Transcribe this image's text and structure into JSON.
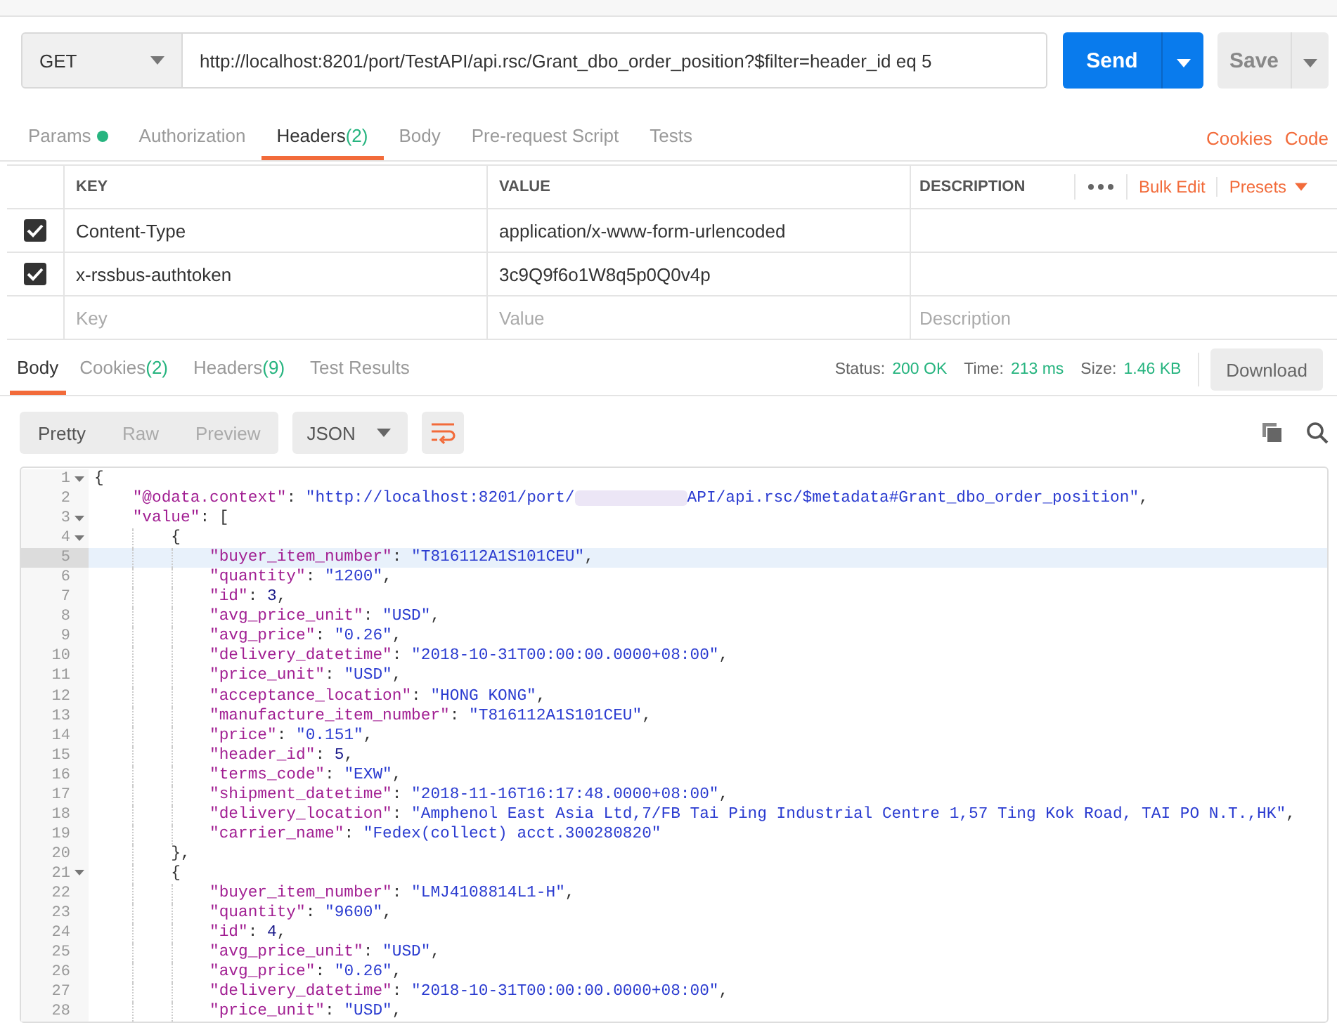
{
  "request": {
    "method": "GET",
    "url": "http://localhost:8201/port/TestAPI/api.rsc/Grant_dbo_order_position?$filter=header_id eq 5",
    "send": "Send",
    "save": "Save"
  },
  "request_tabs": [
    {
      "label": "Params",
      "dot": true,
      "selected": false
    },
    {
      "label": "Authorization",
      "dot": false,
      "selected": false
    },
    {
      "label": "Headers",
      "count": "(2)",
      "dot": false,
      "selected": true
    },
    {
      "label": "Body",
      "dot": false,
      "selected": false
    },
    {
      "label": "Pre-request Script",
      "dot": false,
      "selected": false
    },
    {
      "label": "Tests",
      "dot": false,
      "selected": false
    }
  ],
  "request_links": [
    "Cookies",
    "Code"
  ],
  "headers_table": {
    "columns": [
      "KEY",
      "VALUE",
      "DESCRIPTION"
    ],
    "bulk_edit": "Bulk Edit",
    "presets": "Presets",
    "rows": [
      {
        "key": "Content-Type",
        "value": "application/x-www-form-urlencoded",
        "checked": true
      },
      {
        "key": "x-rssbus-authtoken",
        "value": "3c9Q9f6o1W8q5p0Q0v4p",
        "checked": true
      }
    ],
    "new_row": [
      {
        "placeholder": "Key"
      },
      {
        "placeholder": "Value"
      },
      {
        "placeholder": "Description"
      }
    ]
  },
  "response_tabs": [
    {
      "label": "Body",
      "selected": true
    },
    {
      "label": "Cookies",
      "count": "(2)",
      "selected": false
    },
    {
      "label": "Headers",
      "count": "(9)",
      "selected": false
    },
    {
      "label": "Test Results",
      "selected": false
    }
  ],
  "status": [
    {
      "label": "Status:",
      "value": "200 OK"
    },
    {
      "label": "Time:",
      "value": "213 ms"
    },
    {
      "label": "Size:",
      "value": "1.46 KB"
    }
  ],
  "download": "Download",
  "view_modes": [
    {
      "label": "Pretty",
      "selected": true
    },
    {
      "label": "Raw",
      "selected": false
    },
    {
      "label": "Preview",
      "selected": false
    }
  ],
  "format": "JSON",
  "code": [
    {
      "num": "1",
      "expanded": true,
      "selected": false,
      "tokens": [
        {
          "kind": "p",
          "text": "{"
        }
      ],
      "children": [
        {
          "num": "2",
          "selected": false,
          "tokens": [
            {
              "kind": "key",
              "text": "\"@odata.context\""
            },
            {
              "kind": "p",
              "text": ": "
            },
            {
              "kind": "str",
              "text": "\"http://localhost:8201/port/"
            },
            {
              "kind": "redacted"
            },
            {
              "kind": "str",
              "text": "API/api.rsc/$metadata#Grant_dbo_order_position\""
            },
            {
              "kind": "p",
              "text": ","
            }
          ]
        },
        {
          "num": "3",
          "expanded": true,
          "selected": false,
          "tokens": [
            {
              "kind": "key",
              "text": "\"value\""
            },
            {
              "kind": "p",
              "text": ": ["
            }
          ],
          "children": [
            {
              "num": "4",
              "expanded": true,
              "selected": false,
              "tokens": [
                {
                  "kind": "p",
                  "text": "{"
                }
              ],
              "children": [
                {
                  "num": "5",
                  "selected": true,
                  "tokens": [
                    {
                      "kind": "key",
                      "text": "\"buyer_item_number\""
                    },
                    {
                      "kind": "p",
                      "text": ": "
                    },
                    {
                      "kind": "str",
                      "text": "\"T816112A1S101CEU\""
                    },
                    {
                      "kind": "p",
                      "text": ","
                    }
                  ]
                },
                {
                  "num": "6",
                  "selected": false,
                  "tokens": [
                    {
                      "kind": "key",
                      "text": "\"quantity\""
                    },
                    {
                      "kind": "p",
                      "text": ": "
                    },
                    {
                      "kind": "str",
                      "text": "\"1200\""
                    },
                    {
                      "kind": "p",
                      "text": ","
                    }
                  ]
                },
                {
                  "num": "7",
                  "selected": false,
                  "tokens": [
                    {
                      "kind": "key",
                      "text": "\"id\""
                    },
                    {
                      "kind": "p",
                      "text": ": "
                    },
                    {
                      "kind": "num",
                      "text": "3"
                    },
                    {
                      "kind": "p",
                      "text": ","
                    }
                  ]
                },
                {
                  "num": "8",
                  "selected": false,
                  "tokens": [
                    {
                      "kind": "key",
                      "text": "\"avg_price_unit\""
                    },
                    {
                      "kind": "p",
                      "text": ": "
                    },
                    {
                      "kind": "str",
                      "text": "\"USD\""
                    },
                    {
                      "kind": "p",
                      "text": ","
                    }
                  ]
                },
                {
                  "num": "9",
                  "selected": false,
                  "tokens": [
                    {
                      "kind": "key",
                      "text": "\"avg_price\""
                    },
                    {
                      "kind": "p",
                      "text": ": "
                    },
                    {
                      "kind": "str",
                      "text": "\"0.26\""
                    },
                    {
                      "kind": "p",
                      "text": ","
                    }
                  ]
                },
                {
                  "num": "10",
                  "selected": false,
                  "tokens": [
                    {
                      "kind": "key",
                      "text": "\"delivery_datetime\""
                    },
                    {
                      "kind": "p",
                      "text": ": "
                    },
                    {
                      "kind": "str",
                      "text": "\"2018-10-31T00:00:00.0000+08:00\""
                    },
                    {
                      "kind": "p",
                      "text": ","
                    }
                  ]
                },
                {
                  "num": "11",
                  "selected": false,
                  "tokens": [
                    {
                      "kind": "key",
                      "text": "\"price_unit\""
                    },
                    {
                      "kind": "p",
                      "text": ": "
                    },
                    {
                      "kind": "str",
                      "text": "\"USD\""
                    },
                    {
                      "kind": "p",
                      "text": ","
                    }
                  ]
                },
                {
                  "num": "12",
                  "selected": false,
                  "tokens": [
                    {
                      "kind": "key",
                      "text": "\"acceptance_location\""
                    },
                    {
                      "kind": "p",
                      "text": ": "
                    },
                    {
                      "kind": "str",
                      "text": "\"HONG KONG\""
                    },
                    {
                      "kind": "p",
                      "text": ","
                    }
                  ]
                },
                {
                  "num": "13",
                  "selected": false,
                  "tokens": [
                    {
                      "kind": "key",
                      "text": "\"manufacture_item_number\""
                    },
                    {
                      "kind": "p",
                      "text": ": "
                    },
                    {
                      "kind": "str",
                      "text": "\"T816112A1S101CEU\""
                    },
                    {
                      "kind": "p",
                      "text": ","
                    }
                  ]
                },
                {
                  "num": "14",
                  "selected": false,
                  "tokens": [
                    {
                      "kind": "key",
                      "text": "\"price\""
                    },
                    {
                      "kind": "p",
                      "text": ": "
                    },
                    {
                      "kind": "str",
                      "text": "\"0.151\""
                    },
                    {
                      "kind": "p",
                      "text": ","
                    }
                  ]
                },
                {
                  "num": "15",
                  "selected": false,
                  "tokens": [
                    {
                      "kind": "key",
                      "text": "\"header_id\""
                    },
                    {
                      "kind": "p",
                      "text": ": "
                    },
                    {
                      "kind": "num",
                      "text": "5"
                    },
                    {
                      "kind": "p",
                      "text": ","
                    }
                  ]
                },
                {
                  "num": "16",
                  "selected": false,
                  "tokens": [
                    {
                      "kind": "key",
                      "text": "\"terms_code\""
                    },
                    {
                      "kind": "p",
                      "text": ": "
                    },
                    {
                      "kind": "str",
                      "text": "\"EXW\""
                    },
                    {
                      "kind": "p",
                      "text": ","
                    }
                  ]
                },
                {
                  "num": "17",
                  "selected": false,
                  "tokens": [
                    {
                      "kind": "key",
                      "text": "\"shipment_datetime\""
                    },
                    {
                      "kind": "p",
                      "text": ": "
                    },
                    {
                      "kind": "str",
                      "text": "\"2018-11-16T16:17:48.0000+08:00\""
                    },
                    {
                      "kind": "p",
                      "text": ","
                    }
                  ]
                },
                {
                  "num": "18",
                  "selected": false,
                  "tokens": [
                    {
                      "kind": "key",
                      "text": "\"delivery_location\""
                    },
                    {
                      "kind": "p",
                      "text": ": "
                    },
                    {
                      "kind": "str",
                      "text": "\"Amphenol East Asia Ltd,7/FB Tai Ping Industrial Centre 1,57 Ting Kok Road, TAI PO N.T.,HK\""
                    },
                    {
                      "kind": "p",
                      "text": ","
                    }
                  ]
                },
                {
                  "num": "19",
                  "selected": false,
                  "tokens": [
                    {
                      "kind": "key",
                      "text": "\"carrier_name\""
                    },
                    {
                      "kind": "p",
                      "text": ": "
                    },
                    {
                      "kind": "str",
                      "text": "\"Fedex(collect) acct.300280820\""
                    }
                  ]
                }
              ]
            },
            {
              "num": "20",
              "selected": false,
              "tokens": [
                {
                  "kind": "p",
                  "text": "},"
                }
              ]
            },
            {
              "num": "21",
              "expanded": true,
              "selected": false,
              "tokens": [
                {
                  "kind": "p",
                  "text": "{"
                }
              ],
              "children": [
                {
                  "num": "22",
                  "selected": false,
                  "tokens": [
                    {
                      "kind": "key",
                      "text": "\"buyer_item_number\""
                    },
                    {
                      "kind": "p",
                      "text": ": "
                    },
                    {
                      "kind": "str",
                      "text": "\"LMJ4108814L1-H\""
                    },
                    {
                      "kind": "p",
                      "text": ","
                    }
                  ]
                },
                {
                  "num": "23",
                  "selected": false,
                  "tokens": [
                    {
                      "kind": "key",
                      "text": "\"quantity\""
                    },
                    {
                      "kind": "p",
                      "text": ": "
                    },
                    {
                      "kind": "str",
                      "text": "\"9600\""
                    },
                    {
                      "kind": "p",
                      "text": ","
                    }
                  ]
                },
                {
                  "num": "24",
                  "selected": false,
                  "tokens": [
                    {
                      "kind": "key",
                      "text": "\"id\""
                    },
                    {
                      "kind": "p",
                      "text": ": "
                    },
                    {
                      "kind": "num",
                      "text": "4"
                    },
                    {
                      "kind": "p",
                      "text": ","
                    }
                  ]
                },
                {
                  "num": "25",
                  "selected": false,
                  "tokens": [
                    {
                      "kind": "key",
                      "text": "\"avg_price_unit\""
                    },
                    {
                      "kind": "p",
                      "text": ": "
                    },
                    {
                      "kind": "str",
                      "text": "\"USD\""
                    },
                    {
                      "kind": "p",
                      "text": ","
                    }
                  ]
                },
                {
                  "num": "26",
                  "selected": false,
                  "tokens": [
                    {
                      "kind": "key",
                      "text": "\"avg_price\""
                    },
                    {
                      "kind": "p",
                      "text": ": "
                    },
                    {
                      "kind": "str",
                      "text": "\"0.26\""
                    },
                    {
                      "kind": "p",
                      "text": ","
                    }
                  ]
                },
                {
                  "num": "27",
                  "selected": false,
                  "tokens": [
                    {
                      "kind": "key",
                      "text": "\"delivery_datetime\""
                    },
                    {
                      "kind": "p",
                      "text": ": "
                    },
                    {
                      "kind": "str",
                      "text": "\"2018-10-31T00:00:00.0000+08:00\""
                    },
                    {
                      "kind": "p",
                      "text": ","
                    }
                  ]
                },
                {
                  "num": "28",
                  "selected": false,
                  "tokens": [
                    {
                      "kind": "key",
                      "text": "\"price_unit\""
                    },
                    {
                      "kind": "p",
                      "text": ": "
                    },
                    {
                      "kind": "str",
                      "text": "\"USD\""
                    },
                    {
                      "kind": "p",
                      "text": ","
                    }
                  ]
                }
              ]
            }
          ]
        }
      ]
    }
  ]
}
